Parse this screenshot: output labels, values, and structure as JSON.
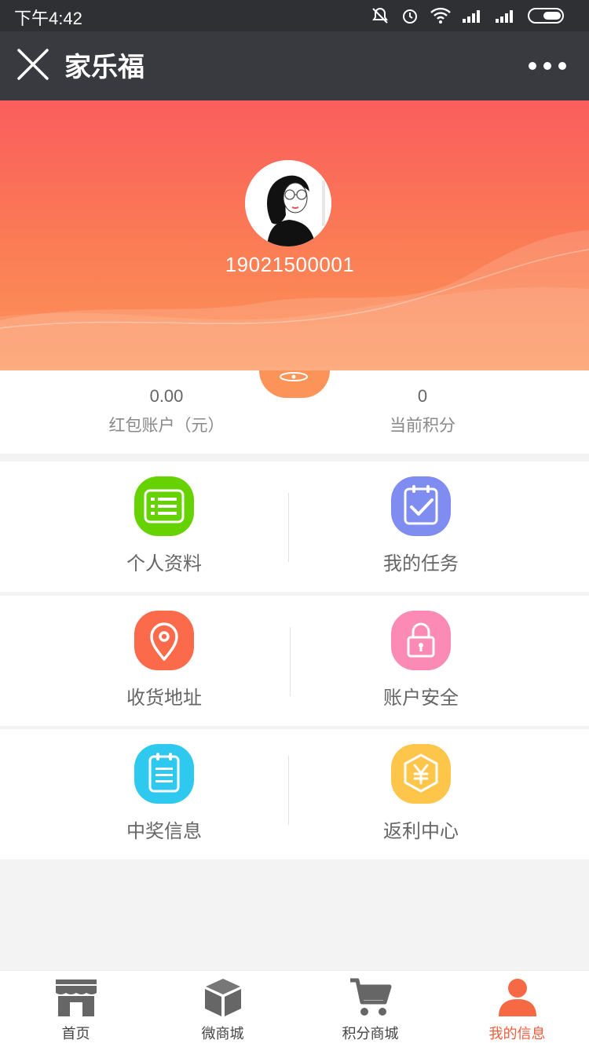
{
  "status_bar": {
    "time": "下午4:42"
  },
  "nav": {
    "title": "家乐福"
  },
  "profile": {
    "username": "19021500001"
  },
  "balance": {
    "red_packet_value": "0.00",
    "red_packet_label": "红包账户（元）",
    "points_value": "0",
    "points_label": "当前积分"
  },
  "menu": [
    {
      "label": "个人资料",
      "icon": "profile-list-icon",
      "color": "#66d202"
    },
    {
      "label": "我的任务",
      "icon": "task-check-icon",
      "color": "#7f8cf0"
    },
    {
      "label": "收货地址",
      "icon": "location-pin-icon",
      "color": "#fb6a4a"
    },
    {
      "label": "账户安全",
      "icon": "lock-icon",
      "color": "#fb8ab4"
    },
    {
      "label": "中奖信息",
      "icon": "notepad-icon",
      "color": "#2fc9f0"
    },
    {
      "label": "返利中心",
      "icon": "yuan-hexagon-icon",
      "color": "#fdc54a"
    }
  ],
  "tabbar": [
    {
      "label": "首页",
      "icon": "store-icon"
    },
    {
      "label": "微商城",
      "icon": "box-icon"
    },
    {
      "label": "积分商城",
      "icon": "cart-icon"
    },
    {
      "label": "我的信息",
      "icon": "user-icon",
      "active": true
    }
  ],
  "colors": {
    "accent": "#f45d3b",
    "nav_bg": "#393a3f",
    "status_bg": "#2f3034",
    "hero_top": "#fa5d5d",
    "hero_bottom": "#fc9459"
  }
}
